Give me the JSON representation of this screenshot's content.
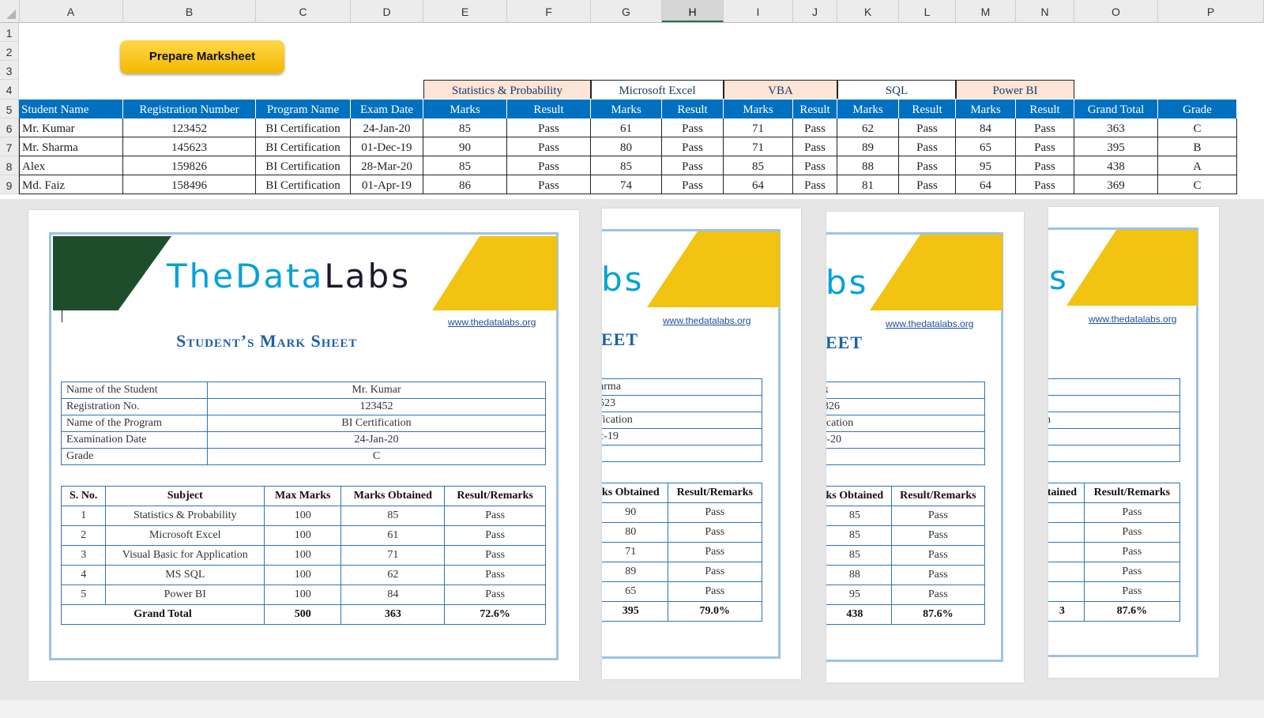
{
  "columns": [
    "A",
    "B",
    "C",
    "D",
    "E",
    "F",
    "G",
    "H",
    "I",
    "J",
    "K",
    "L",
    "M",
    "N",
    "O",
    "P"
  ],
  "rows": [
    "1",
    "2",
    "3",
    "4",
    "5",
    "6",
    "7",
    "8",
    "9"
  ],
  "button_label": "Prepare Marksheet",
  "groups": [
    "Statistics & Probability",
    "Microsoft Excel",
    "VBA",
    "SQL",
    "Power BI"
  ],
  "headers": [
    "Student Name",
    "Registration Number",
    "Program Name",
    "Exam Date",
    "Marks",
    "Result",
    "Marks",
    "Result",
    "Marks",
    "Result",
    "Marks",
    "Result",
    "Marks",
    "Result",
    "Grand Total",
    "Grade"
  ],
  "data_rows": [
    [
      "Mr. Kumar",
      "123452",
      "BI Certification",
      "24-Jan-20",
      "85",
      "Pass",
      "61",
      "Pass",
      "71",
      "Pass",
      "62",
      "Pass",
      "84",
      "Pass",
      "363",
      "C"
    ],
    [
      "Mr. Sharma",
      "145623",
      "BI Certification",
      "01-Dec-19",
      "90",
      "Pass",
      "80",
      "Pass",
      "71",
      "Pass",
      "89",
      "Pass",
      "65",
      "Pass",
      "395",
      "B"
    ],
    [
      "Alex",
      "159826",
      "BI Certification",
      "28-Mar-20",
      "85",
      "Pass",
      "85",
      "Pass",
      "85",
      "Pass",
      "88",
      "Pass",
      "95",
      "Pass",
      "438",
      "A"
    ],
    [
      "Md. Faiz",
      "158496",
      "BI Certification",
      "01-Apr-19",
      "86",
      "Pass",
      "74",
      "Pass",
      "64",
      "Pass",
      "81",
      "Pass",
      "64",
      "Pass",
      "369",
      "C"
    ]
  ],
  "sheet1": {
    "logo_a": "TheData",
    "logo_b": "Labs",
    "url": "www.thedatalabs.org",
    "title": "Student’s Mark Sheet",
    "info": [
      [
        "Name of the Student",
        "Mr. Kumar"
      ],
      [
        "Registration No.",
        "123452"
      ],
      [
        "Name of the Program",
        "BI Certification"
      ],
      [
        "Examination Date",
        "24-Jan-20"
      ],
      [
        "Grade",
        "C"
      ]
    ],
    "marks_header": [
      "S. No.",
      "Subject",
      "Max Marks",
      "Marks Obtained",
      "Result/Remarks"
    ],
    "marks": [
      [
        "1",
        "Statistics & Probability",
        "100",
        "85",
        "Pass"
      ],
      [
        "2",
        "Microsoft Excel",
        "100",
        "61",
        "Pass"
      ],
      [
        "3",
        "Visual Basic for Application",
        "100",
        "71",
        "Pass"
      ],
      [
        "4",
        "MS SQL",
        "100",
        "62",
        "Pass"
      ],
      [
        "5",
        "Power BI",
        "100",
        "84",
        "Pass"
      ]
    ],
    "total": [
      "Grand Total",
      "500",
      "363",
      "72.6%"
    ]
  },
  "sheet2": {
    "logo": "bs",
    "url": "www.thedatalabs.org",
    "title": "EET",
    "info": [
      "arma",
      "523",
      "fication",
      "c-19",
      ":"
    ],
    "marks_header": [
      "ks Obtained",
      "Result/Remarks"
    ],
    "marks": [
      [
        "90",
        "Pass"
      ],
      [
        "80",
        "Pass"
      ],
      [
        "71",
        "Pass"
      ],
      [
        "89",
        "Pass"
      ],
      [
        "65",
        "Pass"
      ]
    ],
    "total": [
      "395",
      "79.0%"
    ]
  },
  "sheet3": {
    "logo": "bs",
    "url": "www.thedatalabs.org",
    "title": "EET",
    "info": [
      "x",
      "326",
      "ication",
      "r-20",
      ""
    ],
    "marks_header": [
      "ks Obtained",
      "Result/Remarks"
    ],
    "marks": [
      [
        "85",
        "Pass"
      ],
      [
        "85",
        "Pass"
      ],
      [
        "85",
        "Pass"
      ],
      [
        "88",
        "Pass"
      ],
      [
        "95",
        "Pass"
      ]
    ],
    "total": [
      "438",
      "87.6%"
    ]
  },
  "sheet4": {
    "logo": "s",
    "url": "www.thedatalabs.org",
    "info": [
      "",
      "",
      "n",
      "",
      ""
    ],
    "marks_header": [
      "tained",
      "Result/Remarks"
    ],
    "marks": [
      [
        "",
        "Pass"
      ],
      [
        "",
        "Pass"
      ],
      [
        "",
        "Pass"
      ],
      [
        "",
        "Pass"
      ],
      [
        "",
        "Pass"
      ]
    ],
    "total": [
      "3",
      "87.6%"
    ]
  },
  "colors": {
    "header_blue": "#0070c0",
    "peach": "#fce4d6",
    "logo_green": "#1e4d2b",
    "logo_yellow": "#f2c311",
    "frame_blue": "#9dc3e6"
  }
}
